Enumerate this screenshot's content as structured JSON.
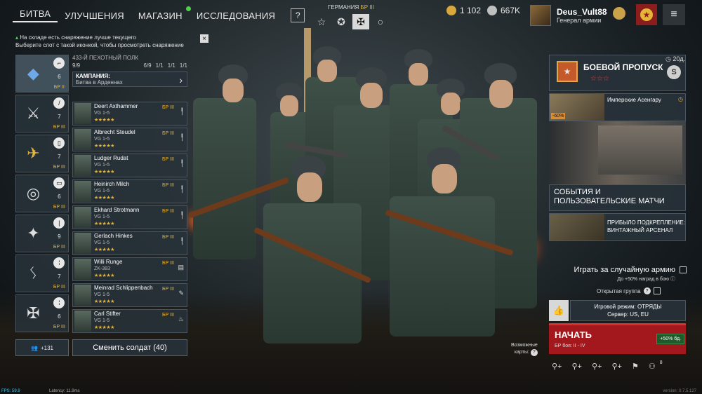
{
  "nav": {
    "items": [
      "БИТВА",
      "УЛУЧШЕНИЯ",
      "МАГАЗИН",
      "ИССЛЕДОВАНИЯ"
    ],
    "help": "?"
  },
  "army": {
    "title": "ГЕРМАНИЯ",
    "br": "БР III",
    "icons": [
      "star-icon",
      "roundel-icon",
      "cross-icon",
      "circle-icon"
    ]
  },
  "currency": {
    "gold": "1 102",
    "silver": "667K",
    "gold_color": "#d8a93a",
    "silver_color": "#bfbfbf"
  },
  "profile": {
    "name": "Deus_Vult88",
    "rank": "Генерал армии"
  },
  "notice": {
    "line1": "На складе есть снаряжение лучше текущего",
    "line2": "Выберите слот с такой иконкой, чтобы просмотреть снаряжение",
    "close": "×"
  },
  "squads": [
    {
      "emblem": "◆",
      "count": "6",
      "br": "БР II",
      "class": "rifle"
    },
    {
      "emblem": "⚔",
      "count": "7",
      "br": "БР III",
      "class": "melee"
    },
    {
      "emblem": "✈",
      "count": "7",
      "br": "БР III",
      "class": "assault"
    },
    {
      "emblem": "◎",
      "count": "6",
      "br": "БР III",
      "class": "tank"
    },
    {
      "emblem": "✦",
      "count": "9",
      "br": "БР III",
      "class": "engineer"
    },
    {
      "emblem": "ᛊ",
      "count": "7",
      "br": "БР III",
      "class": "assault"
    },
    {
      "emblem": "✠",
      "count": "6",
      "br": "БР III",
      "class": "assault"
    }
  ],
  "regiment": {
    "name": "433-Й ПЕХОТНЫЙ ПОЛК",
    "size": "9/9",
    "counts": [
      "6/9",
      "1/1",
      "1/1",
      "1/1"
    ],
    "campaign_label": "КАМПАНИЯ:",
    "campaign": "Битва в Арденнах"
  },
  "soldiers": [
    {
      "name": "Deert Axthammer",
      "weapon": "VG 1-5",
      "stars": "★★★★★",
      "br": "БР III"
    },
    {
      "name": "Albrecht Steudel",
      "weapon": "VG 1-5",
      "stars": "★★★★★",
      "br": "БР III"
    },
    {
      "name": "Ludger Rudat",
      "weapon": "VG 1-5",
      "stars": "★★★★★",
      "br": "БР III"
    },
    {
      "name": "Heinirch Milch",
      "weapon": "VG 1-5",
      "stars": "★★★★★",
      "br": "БР III"
    },
    {
      "name": "Ekhard Strotmann",
      "weapon": "VG 1-5",
      "stars": "★★★★★",
      "br": "БР III"
    },
    {
      "name": "Gerlach Hinkes",
      "weapon": "VG 1-5",
      "stars": "★★★★★",
      "br": "БР III"
    },
    {
      "name": "Willi Runge",
      "weapon": "ZK-383",
      "stars": "★★★★★",
      "br": "БР III"
    },
    {
      "name": "Meinrad Schlippenbach",
      "weapon": "VG 1-5",
      "stars": "★★★★★",
      "br": "БР III"
    },
    {
      "name": "Carl Stifter",
      "weapon": "VG 1-5",
      "stars": "★★★★★",
      "br": "БР III"
    }
  ],
  "bottom": {
    "group_count": "+131",
    "change_soldiers": "Сменить солдат (40)"
  },
  "battle_pass": {
    "days": "20д.",
    "title": "БОЕВОЙ ПРОПУСК",
    "stars": "☆☆☆",
    "s": "S"
  },
  "promo": {
    "title": "Имперские Асенгару",
    "discount": "-60%"
  },
  "events": {
    "title": "СОБЫТИЯ И ПОЛЬЗОВАТЕЛЬСКИЕ МАТЧИ"
  },
  "reinforcement": {
    "title": "ПРИБЫЛО ПОДКРЕПЛЕНИЕ: ВИНТАЖНЫЙ АРСЕНАЛ"
  },
  "random_army": {
    "label": "Играть за случайную армию",
    "sub": "До +50% наград в бою"
  },
  "open_group": {
    "label": "Открытая группа"
  },
  "mode": {
    "line1": "Игровой режим: ОТРЯДЫ",
    "line2": "Сервер: US, EU"
  },
  "start": {
    "label": "НАЧАТЬ",
    "sub": "БР боя: II - IV",
    "bonus": "+50% бд."
  },
  "possible_maps": {
    "line1": "Возможные",
    "line2": "карты:"
  },
  "social": {
    "badge": "8"
  },
  "debug": {
    "fps": "FPS: 59.9",
    "latency": "Latency: 11.9ms",
    "version": "version: 0.7.5.127"
  }
}
